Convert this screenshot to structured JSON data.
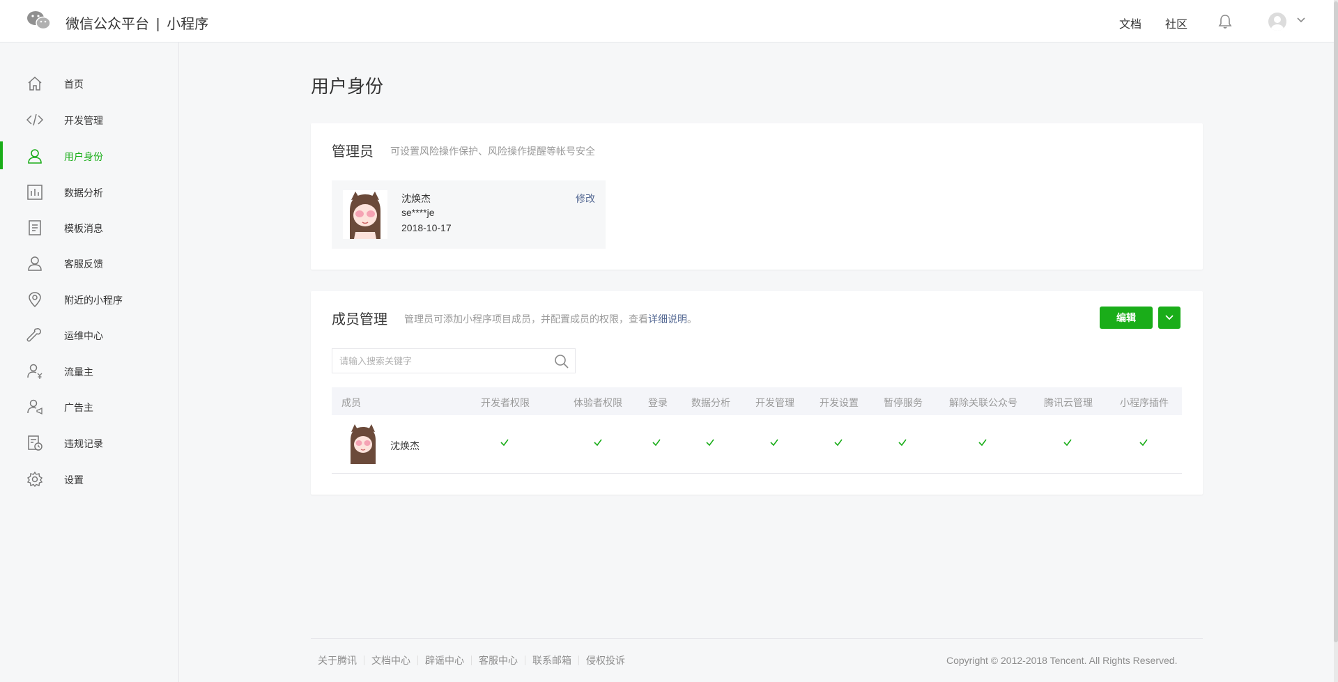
{
  "header": {
    "brand_name": "微信公众平台",
    "brand_separator": "|",
    "brand_product": "小程序",
    "links": [
      "文档",
      "社区"
    ]
  },
  "sidebar": {
    "items": [
      {
        "label": "首页",
        "icon": "home-icon"
      },
      {
        "label": "开发管理",
        "icon": "code-icon"
      },
      {
        "label": "用户身份",
        "icon": "user-icon",
        "active": true
      },
      {
        "label": "数据分析",
        "icon": "bar-chart-icon"
      },
      {
        "label": "模板消息",
        "icon": "document-icon"
      },
      {
        "label": "客服反馈",
        "icon": "customer-service-icon"
      },
      {
        "label": "附近的小程序",
        "icon": "location-icon"
      },
      {
        "label": "运维中心",
        "icon": "wrench-icon"
      },
      {
        "label": "流量主",
        "icon": "user-money-icon"
      },
      {
        "label": "广告主",
        "icon": "user-ad-icon"
      },
      {
        "label": "违规记录",
        "icon": "record-icon"
      },
      {
        "label": "设置",
        "icon": "gear-icon"
      }
    ]
  },
  "main": {
    "title": "用户身份",
    "admin": {
      "title": "管理员",
      "desc": "可设置风险操作保护、风险操作提醒等帐号安全",
      "name": "沈焕杰",
      "account": "se****je",
      "date": "2018-10-17",
      "edit_label": "修改"
    },
    "members": {
      "title": "成员管理",
      "desc_prefix": "管理员可添加小程序项目成员，并配置成员的权限，查看",
      "desc_link": "详细说明",
      "desc_suffix": "。",
      "edit_button": "编辑",
      "search_placeholder": "请输入搜索关键字",
      "columns": [
        "成员",
        "开发者权限",
        "体验者权限",
        "登录",
        "数据分析",
        "开发管理",
        "开发设置",
        "暂停服务",
        "解除关联公众号",
        "腾讯云管理",
        "小程序插件"
      ],
      "rows": [
        {
          "name": "沈焕杰",
          "permissions": [
            true,
            true,
            true,
            true,
            true,
            true,
            true,
            true,
            true,
            true
          ]
        }
      ]
    }
  },
  "footer": {
    "links": [
      "关于腾讯",
      "文档中心",
      "辟谣中心",
      "客服中心",
      "联系邮箱",
      "侵权投诉"
    ],
    "copyright": "Copyright © 2012-2018 Tencent. All Rights Reserved."
  },
  "colors": {
    "accent": "#1aad19",
    "link": "#576b95"
  }
}
